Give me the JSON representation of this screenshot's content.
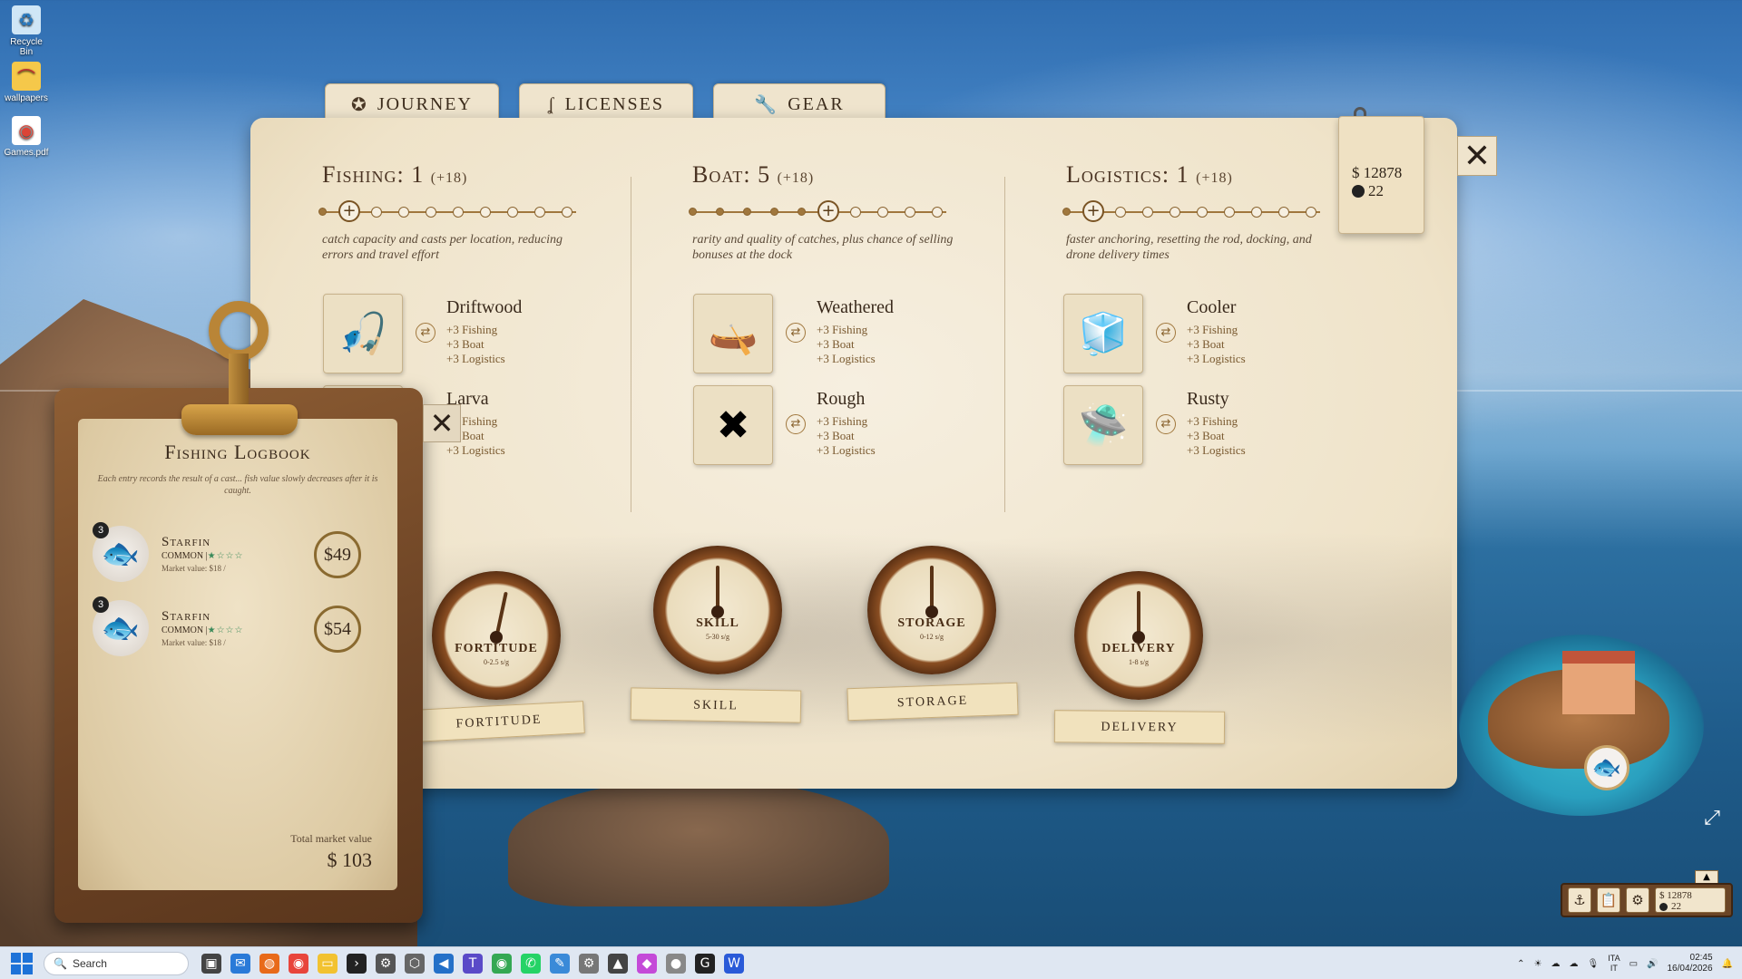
{
  "desktop": {
    "icons": [
      {
        "label": "Recycle Bin",
        "icon": "recycle-bin-icon"
      },
      {
        "label": "wallpapers",
        "icon": "folder-icon"
      },
      {
        "label": "Games.pdf",
        "icon": "chrome-pdf-icon"
      }
    ]
  },
  "tabs": [
    {
      "label": "JOURNEY",
      "icon": "compass-icon"
    },
    {
      "label": "LICENSES",
      "icon": "hook-icon"
    },
    {
      "label": "GEAR",
      "icon": "wrench-icon"
    }
  ],
  "wallet": {
    "money": "$ 12878",
    "tokens": "22"
  },
  "stats": [
    {
      "name": "Fishing:",
      "level": "1",
      "bonus": "(+18)",
      "level_value": 1,
      "level_max": 10,
      "description": "catch capacity and casts per location, reducing errors and travel effort",
      "items": [
        {
          "name": "Driftwood",
          "icon": "fishing-rod-icon",
          "glyph": "🎣",
          "b1": "+3 Fishing",
          "b2": "+3 Boat",
          "b3": "+3 Logistics"
        },
        {
          "name": "Larva",
          "icon": "bait-icon",
          "glyph": "🪱",
          "b1": "+3 Fishing",
          "b2": "+3 Boat",
          "b3": "+3 Logistics"
        }
      ]
    },
    {
      "name": "Boat:",
      "level": "5",
      "bonus": "(+18)",
      "level_value": 5,
      "level_max": 10,
      "description": "rarity and quality of catches, plus chance of selling bonuses at the dock",
      "items": [
        {
          "name": "Weathered",
          "icon": "rowboat-icon",
          "glyph": "🛶",
          "b1": "+3 Fishing",
          "b2": "+3 Boat",
          "b3": "+3 Logistics"
        },
        {
          "name": "Rough",
          "icon": "oars-icon",
          "glyph": "✖",
          "b1": "+3 Fishing",
          "b2": "+3 Boat",
          "b3": "+3 Logistics"
        }
      ]
    },
    {
      "name": "Logistics:",
      "level": "1",
      "bonus": "(+18)",
      "level_value": 1,
      "level_max": 10,
      "description": "faster anchoring, resetting the rod, docking, and drone delivery times",
      "items": [
        {
          "name": "Cooler",
          "icon": "cooler-icon",
          "glyph": "🧊",
          "b1": "+3 Fishing",
          "b2": "+3 Boat",
          "b3": "+3 Logistics"
        },
        {
          "name": "Rusty",
          "icon": "drone-icon",
          "glyph": "🛸",
          "b1": "+3 Fishing",
          "b2": "+3 Boat",
          "b3": "+3 Logistics"
        }
      ]
    }
  ],
  "gauges": [
    {
      "label": "FORTITUDE",
      "dial_text": "FORTITUDE",
      "range": "0-2.5 s/g",
      "level": 0.55
    },
    {
      "label": "SKILL",
      "dial_text": "SKILL",
      "range": "5-30 s/g",
      "level": 0.5
    },
    {
      "label": "STORAGE",
      "dial_text": "STORAGE",
      "range": "0-12 s/g",
      "level": 0.5
    },
    {
      "label": "DELIVERY",
      "dial_text": "DELIVERY",
      "range": "1-8 s/g",
      "level": 0.5
    }
  ],
  "logbook": {
    "title": "Fishing Logbook",
    "subtitle": "Each entry records the result of a cast... fish value slowly decreases after it is caught.",
    "entries": [
      {
        "count": "3",
        "name": "Starfin",
        "rarity": "COMMON |",
        "stars": "★☆☆☆",
        "market": "Market value: $18 /",
        "price": "$49"
      },
      {
        "count": "3",
        "name": "Starfin",
        "rarity": "COMMON |",
        "stars": "★☆☆☆",
        "market": "Market value: $18 /",
        "price": "$54"
      }
    ],
    "total_label": "Total market value",
    "total_value": "$ 103"
  },
  "hud": {
    "money": "$ 12878",
    "tokens": "22"
  },
  "taskbar": {
    "search_placeholder": "Search",
    "lang1": "ITA",
    "lang2": "IT",
    "time": "02:45",
    "date": "16/04/2026"
  }
}
